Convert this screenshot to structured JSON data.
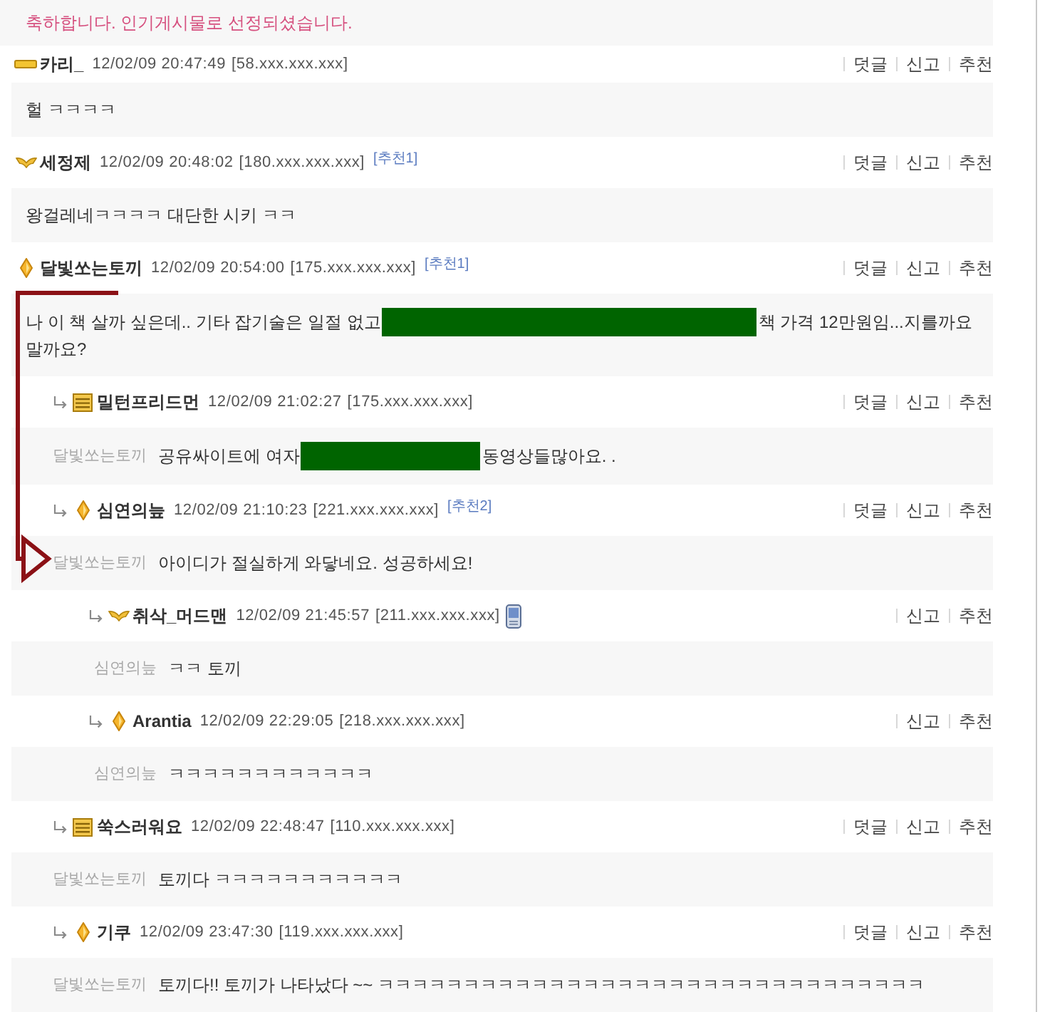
{
  "banner": {
    "text": "축하합니다. 인기게시물로 선정되셨습니다."
  },
  "comments": [
    {
      "author": "카리_",
      "badge": {
        "kind": "bar"
      },
      "timestamp": "12/02/09 20:47:49",
      "ip": "[58.xxx.xxx.xxx]",
      "mobile": false,
      "actions": [
        "덧글",
        "신고",
        "추천"
      ],
      "message": [
        {
          "kind": "text",
          "text": "헐 ㅋㅋㅋㅋ"
        }
      ]
    },
    {
      "author": "세정제",
      "badge": {
        "kind": "wings"
      },
      "timestamp": "12/02/09 20:48:02",
      "ip": "[180.xxx.xxx.xxx]",
      "recommend": "[추천1]",
      "mobile": false,
      "actions": [
        "덧글",
        "신고",
        "추천"
      ],
      "message": [
        {
          "kind": "text",
          "text": "왕걸레네ㅋㅋㅋㅋ 대단한 시키 ㅋㅋ"
        }
      ]
    },
    {
      "author": "달빛쏘는토끼",
      "badge": {
        "kind": "gem"
      },
      "timestamp": "12/02/09 20:54:00",
      "ip": "[175.xxx.xxx.xxx]",
      "recommend": "[추천1]",
      "mobile": false,
      "actions": [
        "덧글",
        "신고",
        "추천"
      ],
      "message": [
        {
          "kind": "text",
          "text": "나 이 책 살까 싶은데.. 기타 잡기술은 일절 없고"
        },
        {
          "kind": "redacted"
        },
        {
          "kind": "text",
          "text": "책 가격 12만원임...지를까요"
        },
        {
          "kind": "text",
          "text": "말까요?"
        }
      ],
      "children": [
        {
          "author": "밀턴프리드먼",
          "badge": {
            "kind": "stack"
          },
          "timestamp": "12/02/09 21:02:27",
          "ip": "[175.xxx.xxx.xxx]",
          "mobile": false,
          "actions": [
            "덧글",
            "신고",
            "추천"
          ],
          "reply_to": "달빛쏘는토끼",
          "message": [
            {
              "kind": "text",
              "text": "공유싸이트에 여자"
            },
            {
              "kind": "redacted"
            },
            {
              "kind": "text",
              "text": "동영상들많아요. ."
            }
          ]
        },
        {
          "author": "심연의늪",
          "badge": {
            "kind": "gem"
          },
          "timestamp": "12/02/09 21:10:23",
          "ip": "[221.xxx.xxx.xxx]",
          "recommend": "[추천2]",
          "mobile": false,
          "actions": [
            "덧글",
            "신고",
            "추천"
          ],
          "reply_to": "달빛쏘는토끼",
          "message": [
            {
              "kind": "text",
              "text": "아이디가 절실하게 와닿네요. 성공하세요!"
            }
          ],
          "children": [
            {
              "author": "취삭_머드맨",
              "badge": {
                "kind": "wings"
              },
              "timestamp": "12/02/09 21:45:57",
              "ip": "[211.xxx.xxx.xxx]",
              "mobile": true,
              "actions": [
                "신고",
                "추천"
              ],
              "reply_to": "심연의늪",
              "message": [
                {
                  "kind": "text",
                  "text": "ㅋㅋ 토끼"
                }
              ]
            },
            {
              "author": "Arantia",
              "badge": {
                "kind": "gem"
              },
              "timestamp": "12/02/09 22:29:05",
              "ip": "[218.xxx.xxx.xxx]",
              "mobile": false,
              "actions": [
                "신고",
                "추천"
              ],
              "reply_to": "심연의늪",
              "message": [
                {
                  "kind": "text",
                  "text": "ㅋㅋㅋㅋㅋㅋㅋㅋㅋㅋㅋㅋ"
                }
              ]
            }
          ]
        },
        {
          "author": "쑥스러워요",
          "badge": {
            "kind": "stack"
          },
          "timestamp": "12/02/09 22:48:47",
          "ip": "[110.xxx.xxx.xxx]",
          "mobile": false,
          "actions": [
            "덧글",
            "신고",
            "추천"
          ],
          "reply_to": "달빛쏘는토끼",
          "message": [
            {
              "kind": "text",
              "text": "토끼다 ㅋㅋㅋㅋㅋㅋㅋㅋㅋㅋㅋ"
            }
          ]
        },
        {
          "author": "기쿠",
          "badge": {
            "kind": "gem"
          },
          "timestamp": "12/02/09 23:47:30",
          "ip": "[119.xxx.xxx.xxx]",
          "mobile": false,
          "actions": [
            "덧글",
            "신고",
            "추천"
          ],
          "reply_to": "달빛쏘는토끼",
          "message": [
            {
              "kind": "text",
              "text": "토끼다!! 토끼가 나타났다 ~~ ㅋㅋㅋㅋㅋㅋㅋㅋㅋㅋㅋㅋㅋㅋㅋㅋㅋㅋㅋㅋㅋㅋㅋㅋㅋㅋㅋㅋㅋㅋㅋㅋ"
            }
          ]
        }
      ]
    }
  ]
}
